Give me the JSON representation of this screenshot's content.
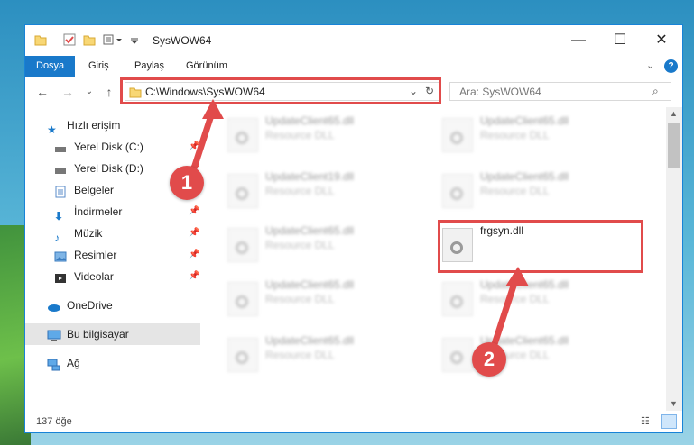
{
  "window": {
    "title": "SysWOW64"
  },
  "ribbon": {
    "tabs": [
      "Dosya",
      "Giriş",
      "Paylaş",
      "Görünüm"
    ]
  },
  "address": {
    "path": "C:\\Windows\\SysWOW64"
  },
  "search": {
    "placeholder": "Ara: SysWOW64"
  },
  "nav": {
    "items": [
      {
        "label": "Hızlı erişim",
        "icon": "star-icon"
      },
      {
        "label": "Yerel Disk (C:)",
        "icon": "drive-icon"
      },
      {
        "label": "Yerel Disk (D:)",
        "icon": "drive-icon"
      },
      {
        "label": "Belgeler",
        "icon": "documents-icon"
      },
      {
        "label": "İndirmeler",
        "icon": "download-icon"
      },
      {
        "label": "Müzik",
        "icon": "music-icon"
      },
      {
        "label": "Resimler",
        "icon": "pictures-icon"
      },
      {
        "label": "Videolar",
        "icon": "video-icon"
      },
      {
        "label": "OneDrive",
        "icon": "cloud-icon"
      },
      {
        "label": "Bu bilgisayar",
        "icon": "computer-icon"
      },
      {
        "label": "Ağ",
        "icon": "network-icon"
      }
    ]
  },
  "files": [
    {
      "name": "UpdateClient65.dll",
      "type": "Resource DLL"
    },
    {
      "name": "UpdateClient65.dll",
      "type": "Resource DLL"
    },
    {
      "name": "UpdateClient19.dll",
      "type": "Resource DLL"
    },
    {
      "name": "UpdateClient65.dll",
      "type": "Resource DLL"
    },
    {
      "name": "UpdateClient65.dll",
      "type": "Resource DLL"
    },
    {
      "name": "frgsyn.dll",
      "type": ""
    },
    {
      "name": "UpdateClient65.dll",
      "type": "Resource DLL"
    },
    {
      "name": "UpdateClient65.dll",
      "type": "Resource DLL"
    },
    {
      "name": "UpdateClient65.dll",
      "type": "Resource DLL"
    },
    {
      "name": "UpdateClient65.dll",
      "type": "Resource DLL"
    }
  ],
  "status": {
    "count": "137 öğe"
  },
  "annotations": {
    "badge1": "1",
    "badge2": "2"
  },
  "colors": {
    "accent": "#1979ca",
    "highlight": "#e14b4b"
  }
}
